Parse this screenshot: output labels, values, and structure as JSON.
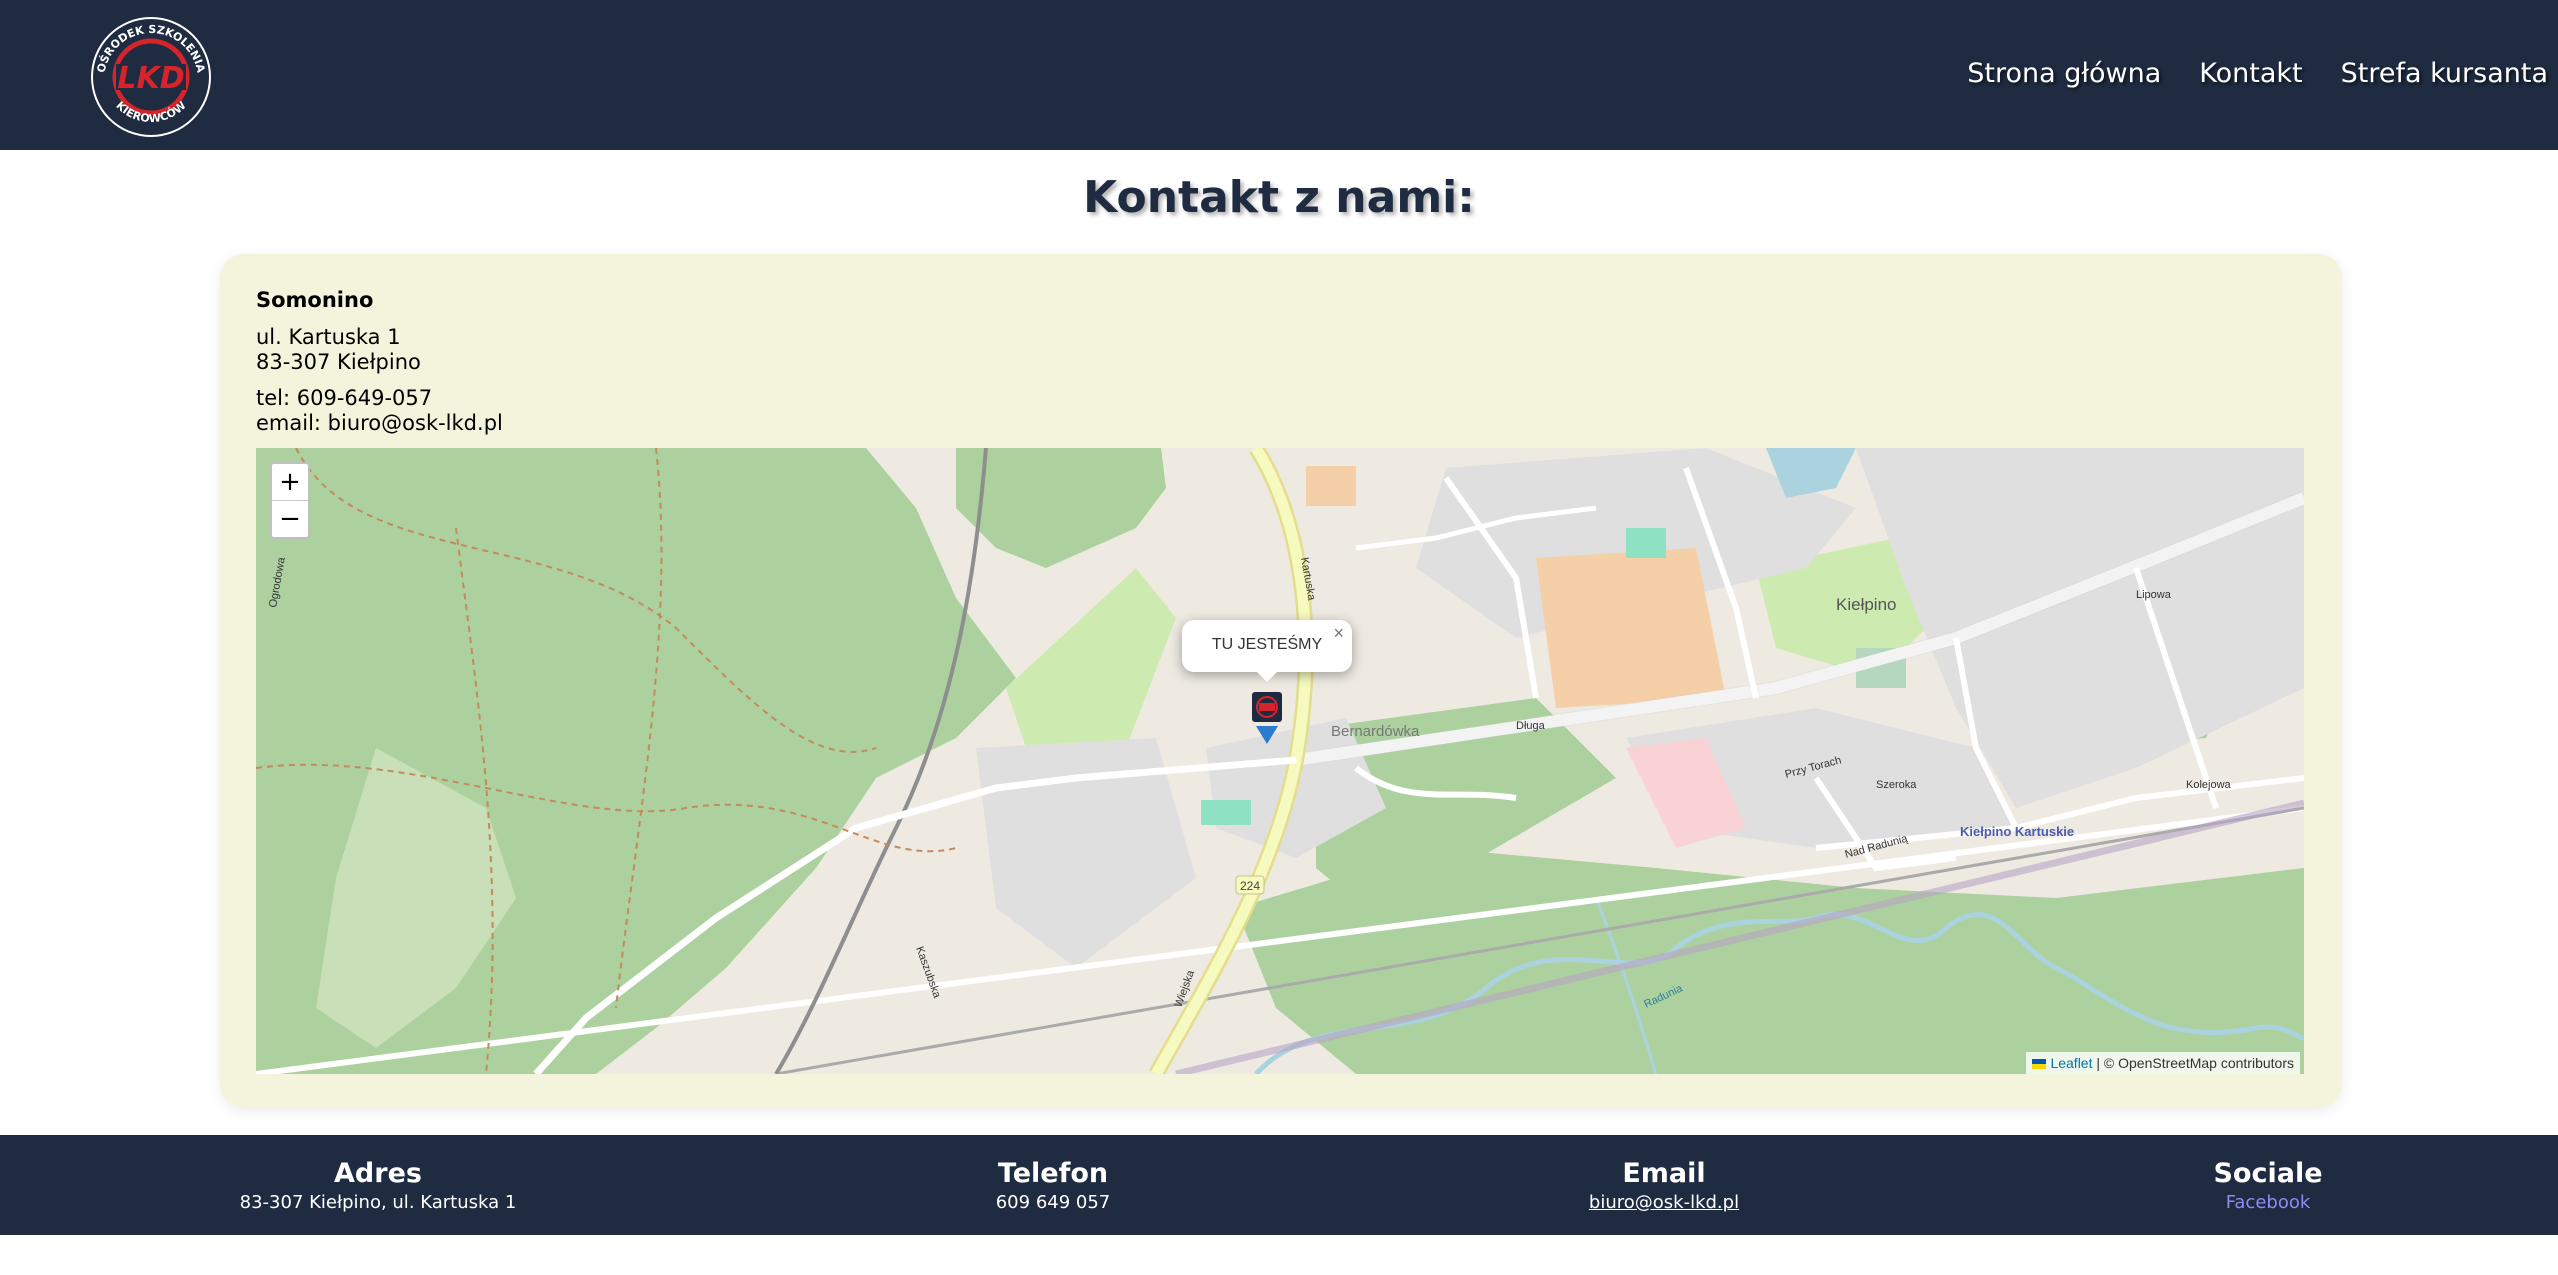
{
  "brand": {
    "logo_text": "LKD",
    "logo_ring_top": "OŚRODEK SZKOLENIA",
    "logo_ring_bottom": "KIEROWCÓW"
  },
  "nav": [
    {
      "label": "Strona główna"
    },
    {
      "label": "Kontakt"
    },
    {
      "label": "Strefa kursanta"
    }
  ],
  "page": {
    "title": "Kontakt z nami:"
  },
  "contact": {
    "city": "Somonino",
    "street": "ul. Kartuska 1",
    "postal": "83-307 Kiełpino",
    "phone": "tel: 609-649-057",
    "email": "email: biuro@osk-lkd.pl"
  },
  "map": {
    "zoom_in": "+",
    "zoom_out": "−",
    "popup_text": "TU JESTEŚMY",
    "popup_close": "×",
    "place_labels": [
      "Kiełpino",
      "Bernardówka",
      "Kiełpino Kartuskie"
    ],
    "street_labels": [
      "Długa",
      "Kartuska",
      "Wiejska",
      "Radunia",
      "Szeroka",
      "Kolejowa",
      "Ogrodowa",
      "Kaszubska",
      "Lipowa",
      "Przy Torach",
      "Nad Radunią",
      "224"
    ],
    "attribution": {
      "leaflet": "Leaflet",
      "rest": "| © OpenStreetMap contributors"
    }
  },
  "footer": {
    "address": {
      "heading": "Adres",
      "value": "83-307 Kiełpino, ul. Kartuska 1"
    },
    "phone": {
      "heading": "Telefon",
      "value": "609 649 057"
    },
    "email": {
      "heading": "Email",
      "value": "biuro@osk-lkd.pl"
    },
    "social": {
      "heading": "Sociale",
      "value": "Facebook"
    }
  },
  "colors": {
    "header_bg": "#1f2b41",
    "card_bg": "#f4f4dc",
    "forest": "#add19e",
    "road_major": "#f7fabf",
    "water": "#aad3df",
    "footer_link": "#8c8cf5"
  }
}
